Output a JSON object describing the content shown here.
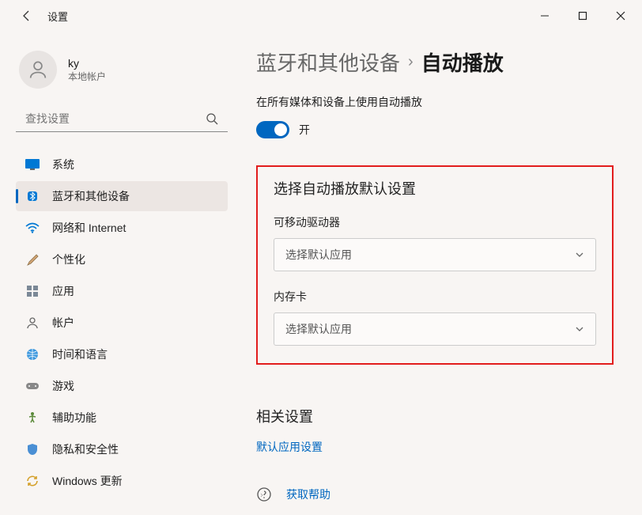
{
  "titlebar": {
    "app_title": "设置"
  },
  "user": {
    "name": "ky",
    "account_type": "本地帐户"
  },
  "search": {
    "placeholder": "查找设置"
  },
  "nav": {
    "items": [
      "系统",
      "蓝牙和其他设备",
      "网络和 Internet",
      "个性化",
      "应用",
      "帐户",
      "时间和语言",
      "游戏",
      "辅助功能",
      "隐私和安全性",
      "Windows 更新"
    ]
  },
  "breadcrumb": {
    "parent": "蓝牙和其他设备",
    "sep": "›",
    "current": "自动播放"
  },
  "content": {
    "toggle_label": "在所有媒体和设备上使用自动播放",
    "toggle_state": "开",
    "defaults_heading": "选择自动播放默认设置",
    "removable_label": "可移动驱动器",
    "removable_value": "选择默认应用",
    "memory_label": "内存卡",
    "memory_value": "选择默认应用",
    "related_heading": "相关设置",
    "default_apps_link": "默认应用设置",
    "get_help": "获取帮助"
  }
}
